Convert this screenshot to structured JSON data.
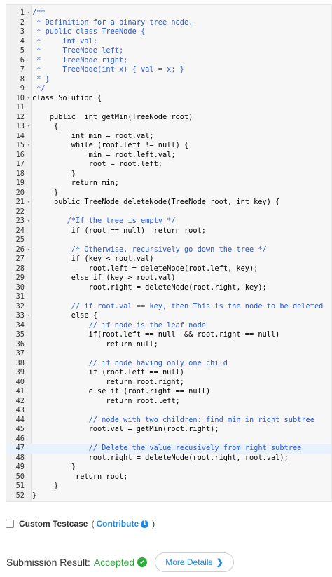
{
  "editor": {
    "fold_glyph": "▾",
    "lines": [
      {
        "n": "1",
        "fold": true,
        "text": "/**",
        "cls": "comment"
      },
      {
        "n": "2",
        "text": " * Definition for a binary tree node.",
        "cls": "comment"
      },
      {
        "n": "3",
        "text": " * public class TreeNode {",
        "cls": "comment"
      },
      {
        "n": "4",
        "text": " *     int val;",
        "cls": "comment"
      },
      {
        "n": "5",
        "text": " *     TreeNode left;",
        "cls": "comment"
      },
      {
        "n": "6",
        "text": " *     TreeNode right;",
        "cls": "comment"
      },
      {
        "n": "7",
        "text": " *     TreeNode(int x) { val = x; }",
        "cls": "comment"
      },
      {
        "n": "8",
        "text": " * }",
        "cls": "comment"
      },
      {
        "n": "9",
        "text": " */",
        "cls": "comment"
      },
      {
        "n": "10",
        "fold": true,
        "text": "class Solution {"
      },
      {
        "n": "11",
        "text": ""
      },
      {
        "n": "12",
        "text": "    public  int getMin(TreeNode root)"
      },
      {
        "n": "13",
        "fold": true,
        "text": "     {"
      },
      {
        "n": "14",
        "text": "         int min = root.val;"
      },
      {
        "n": "15",
        "fold": true,
        "text": "         while (root.left != null) {"
      },
      {
        "n": "16",
        "text": "             min = root.left.val;"
      },
      {
        "n": "17",
        "text": "             root = root.left;"
      },
      {
        "n": "18",
        "text": "         }"
      },
      {
        "n": "19",
        "text": "         return min;"
      },
      {
        "n": "20",
        "text": "     }"
      },
      {
        "n": "21",
        "fold": true,
        "text": "     public TreeNode deleteNode(TreeNode root, int key) {"
      },
      {
        "n": "22",
        "text": ""
      },
      {
        "n": "23",
        "fold": true,
        "text": "        /*If the tree is empty */",
        "cls": "comment"
      },
      {
        "n": "24",
        "text": "         if (root == null)  return root;"
      },
      {
        "n": "25",
        "text": ""
      },
      {
        "n": "26",
        "fold": true,
        "text": "         /* Otherwise, recursively go down the tree */",
        "cls": "comment"
      },
      {
        "n": "27",
        "text": "         if (key < root.val)"
      },
      {
        "n": "28",
        "text": "             root.left = deleteNode(root.left, key);"
      },
      {
        "n": "29",
        "text": "         else if (key > root.val)"
      },
      {
        "n": "30",
        "text": "             root.right = deleteNode(root.right, key);"
      },
      {
        "n": "31",
        "text": ""
      },
      {
        "n": "32",
        "text": "         // if root.val == key, then This is the node to be deleted",
        "cls": "comment"
      },
      {
        "n": "33",
        "fold": true,
        "text": "         else {"
      },
      {
        "n": "34",
        "text": "             // if node is the leaf node",
        "cls": "comment"
      },
      {
        "n": "35",
        "text": "             if(root.left == null  && root.right == null)"
      },
      {
        "n": "36",
        "text": "                 return null;"
      },
      {
        "n": "37",
        "text": ""
      },
      {
        "n": "38",
        "text": "             // if node having only one child",
        "cls": "comment"
      },
      {
        "n": "39",
        "text": "             if (root.left == null)"
      },
      {
        "n": "40",
        "text": "                 return root.right;"
      },
      {
        "n": "41",
        "text": "             else if (root.right == null)"
      },
      {
        "n": "42",
        "text": "                 return root.left;"
      },
      {
        "n": "43",
        "text": ""
      },
      {
        "n": "44",
        "text": "             // node with two children: find min in right subtree",
        "cls": "comment"
      },
      {
        "n": "45",
        "text": "             root.val = getMin(root.right);"
      },
      {
        "n": "46",
        "text": ""
      },
      {
        "n": "47",
        "active": true,
        "text": "             // Delete the value recusively from right subtree",
        "cls": "comment"
      },
      {
        "n": "48",
        "text": "             root.right = deleteNode(root.right, root.val);"
      },
      {
        "n": "49",
        "text": "         }"
      },
      {
        "n": "50",
        "text": "          return root;"
      },
      {
        "n": "51",
        "text": "     }"
      },
      {
        "n": "52",
        "text": "}"
      }
    ]
  },
  "testcase": {
    "label": "Custom Testcase",
    "open_paren": "(",
    "contribute": "Contribute",
    "info_glyph": "i",
    "close_paren": ")"
  },
  "result": {
    "label": "Submission Result:",
    "status": "Accepted",
    "status_color": "#2eaa3f",
    "check_glyph": "✔",
    "more_label": "More Details",
    "more_chevron": "❯"
  }
}
